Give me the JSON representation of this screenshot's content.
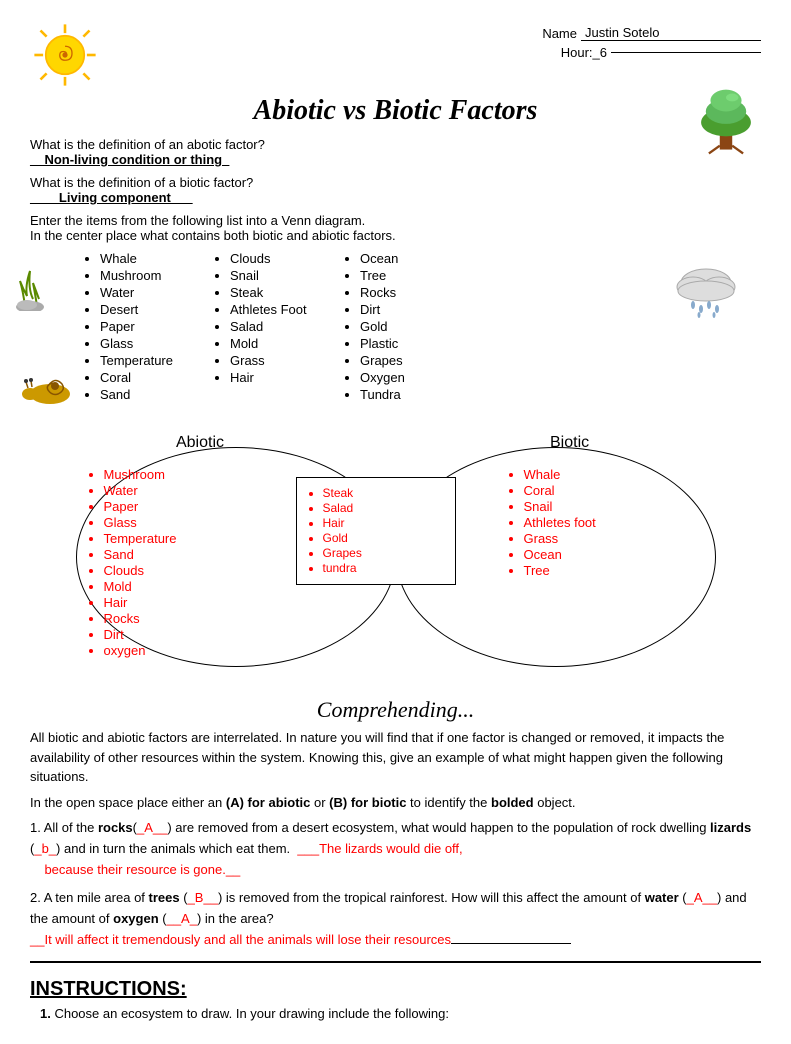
{
  "header": {
    "name_label": "Name",
    "name_value": "Justin Sotelo",
    "hour_label": "Hour:_6",
    "name_underline": "Justin Sotelo____________________",
    "hour_underline": "_6______________________"
  },
  "title": "Abiotic vs Biotic Factors",
  "definitions": {
    "abiotic_question": "What is the definition of an abotic factor?",
    "abiotic_answer": "__Non-living condition or thing_",
    "biotic_question": "What is the definition of a biotic factor?",
    "biotic_answer": "____Living component___"
  },
  "venn_intro": {
    "line1": "Enter the items from the following list into a Venn diagram.",
    "line2": "In the center place what contains both biotic and abiotic factors."
  },
  "list_col1": [
    "Whale",
    "Mushroom",
    "Water",
    "Desert",
    "Paper",
    "Glass",
    "Temperature",
    "Coral",
    "Sand"
  ],
  "list_col2": [
    "Clouds",
    "Snail",
    "Steak",
    "Athletes Foot",
    "Salad",
    "Mold",
    "Grass",
    "Hair"
  ],
  "list_col3": [
    "Ocean",
    "Tree",
    "Rocks",
    "Dirt",
    "Gold",
    "Plastic",
    "Grapes",
    "Oxygen",
    "Tundra"
  ],
  "venn": {
    "abiotic_label": "Abiotic",
    "biotic_label": "Biotic",
    "left_items": [
      "Mushroom",
      "Water",
      "Paper",
      "Glass",
      "Temperature",
      "Sand",
      "Clouds",
      "Mold",
      "Hair",
      "Rocks",
      "Dirt",
      "oxygen"
    ],
    "center_items": [
      "Steak",
      "Salad",
      "Hair",
      "Gold",
      "Grapes",
      "tundra"
    ],
    "right_items": [
      "Whale",
      "Coral",
      "Snail",
      "Athletes foot",
      "Grass",
      "Ocean",
      "Tree"
    ]
  },
  "comprehending": {
    "title": "Comprehending...",
    "para1": "All biotic and abiotic factors are interrelated.  In nature you will find that if one factor is changed or removed, it impacts the availability of other resources within the system.  Knowing this, give an example of what might happen given the following situations.",
    "para2": "In the open space place either an (A) for abiotic or (B) for biotic to identify the bolded object.",
    "q1_text": "All of the rocks(_A__) are removed from a desert ecosystem, what would happen to the population of rock dwelling lizards (_b_) and in turn the animals which eat them.",
    "q1_answer": "The lizards would die off, because their resource is gone.",
    "q2_text": "A ten mile area of trees (_B__) is removed from the tropical rainforest.  How will this affect the amount of water (_A__) and the amount of oxygen (__A_) in the area?",
    "q2_answer": "_It will affect it tremendously and all the animals will lose their resources"
  },
  "instructions": {
    "title": "INSTRUCTIONS:",
    "items": [
      "1.  Choose an ecosystem to draw.  In your drawing include the following:"
    ]
  }
}
